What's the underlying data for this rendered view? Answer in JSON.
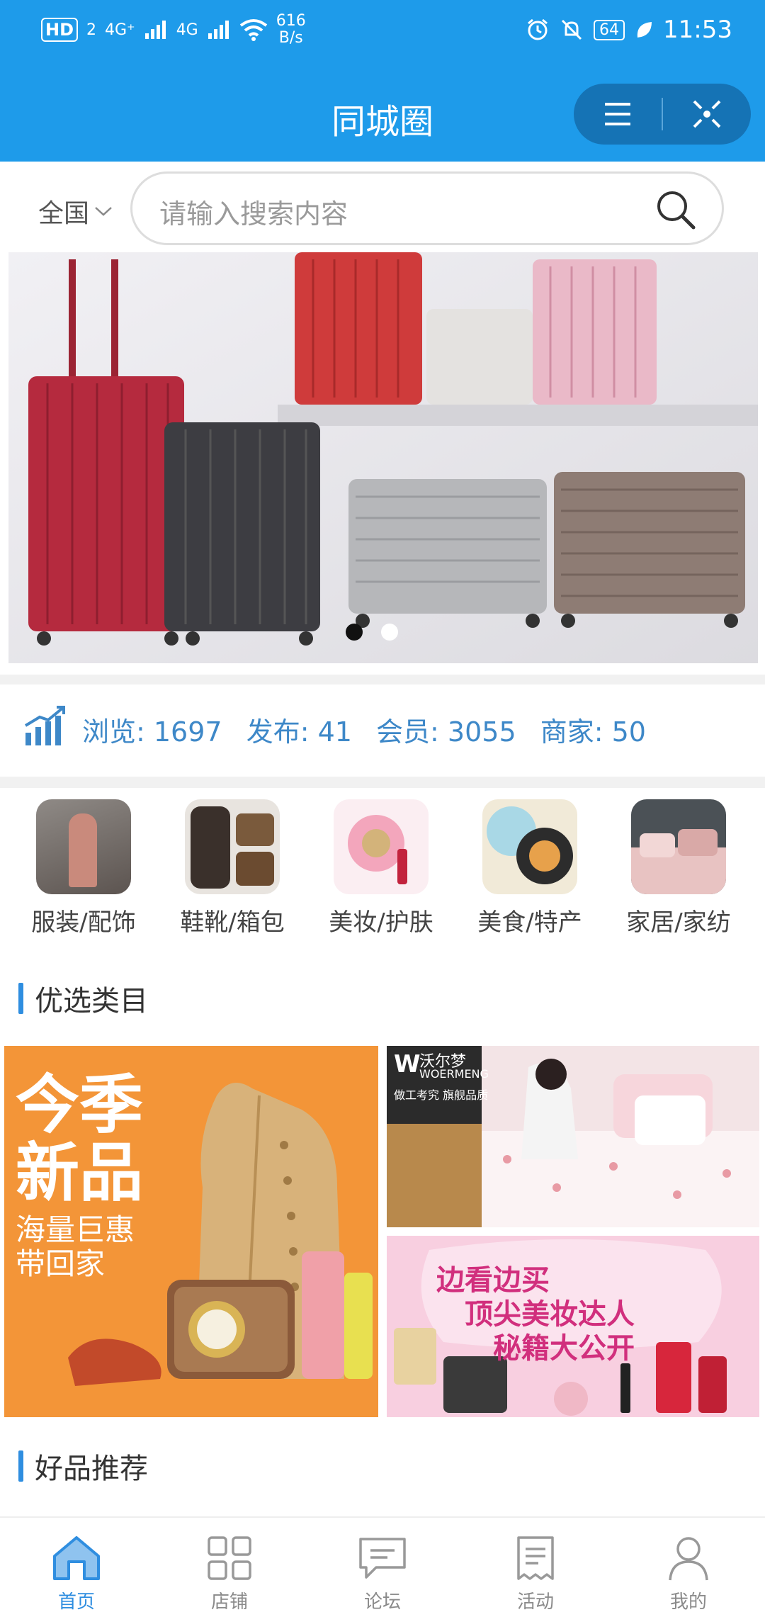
{
  "status_bar": {
    "hd": "HD",
    "sim": "2",
    "net1": "4G⁺",
    "net2": "4G",
    "speed_value": "616",
    "speed_unit": "B/s",
    "battery": "64",
    "time": "11:53"
  },
  "header": {
    "title": "同城圈"
  },
  "search": {
    "region": "全国",
    "placeholder": "请输入搜索内容"
  },
  "banner": {
    "active_dot": 0,
    "dot_count": 2
  },
  "stats": [
    {
      "label": "浏览: 1697"
    },
    {
      "label": "发布: 41"
    },
    {
      "label": "会员: 3055"
    },
    {
      "label": "商家: 50"
    }
  ],
  "categories": [
    {
      "label": "服装/配饰"
    },
    {
      "label": "鞋靴/箱包"
    },
    {
      "label": "美妆/护肤"
    },
    {
      "label": "美食/特产"
    },
    {
      "label": "家居/家纺"
    }
  ],
  "sections": {
    "featured": "优选类目",
    "recommended": "好品推荐"
  },
  "promos": {
    "left": {
      "line1": "今季",
      "line2": "新品",
      "line3": "海量巨惠",
      "line4": "带回家"
    },
    "right_top": {
      "brand_cn": "沃尔梦",
      "brand_en": "WOERMENG",
      "slogan": "做工考究 旗舰品质"
    },
    "right_bottom": {
      "line1": "边看边买",
      "line2": "顶尖美妆达人",
      "line3": "秘籍大公开"
    }
  },
  "nav": {
    "tabs": [
      {
        "label": "首页",
        "icon": "home-icon"
      },
      {
        "label": "店铺",
        "icon": "grid-icon"
      },
      {
        "label": "论坛",
        "icon": "chat-icon"
      },
      {
        "label": "活动",
        "icon": "receipt-icon"
      },
      {
        "label": "我的",
        "icon": "user-icon"
      }
    ],
    "active_index": 0
  },
  "colors": {
    "primary": "#1e9bea",
    "accent": "#2f8ee0",
    "stats_text": "#3e88c8"
  }
}
